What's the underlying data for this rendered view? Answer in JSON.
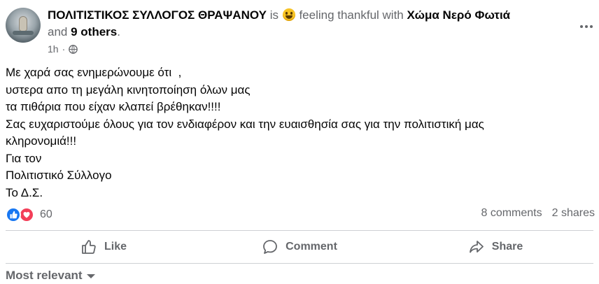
{
  "post": {
    "author": "ΠΟΛΙΤΙΣΤΙΚΟΣ ΣΥΛΛΟΓΟΣ ΘΡΑΨΑΝΟΥ",
    "is_text": "is",
    "feeling_text": "feeling thankful with",
    "tagged": "Χώμα Νερό Φωτιά",
    "and_text": "and",
    "others": "9 others",
    "period": ".",
    "time": "1h",
    "separator": "·",
    "privacy_icon": "globe-icon",
    "more_icon": "more-options-icon",
    "body_lines": [
      "Με χαρά σας ενημερώνουμε ότι  ,",
      "υστερα απο τη μεγάλη κινητοποίηση όλων μας",
      "τα πιθάρια που είχαν κλαπεί βρέθηκαν!!!!",
      "Σας ευχαριστούμε όλους για τον ενδιαφέρον και την ευαισθησία σας για την πολιτιστική μας",
      "κληρονομιά!!!",
      "Για τον",
      "Πολιτιστικό Σύλλογο",
      "Το Δ.Σ."
    ]
  },
  "engagement": {
    "reaction_count": "60",
    "comments": "8 comments",
    "shares": "2 shares"
  },
  "actions": {
    "like": "Like",
    "comment": "Comment",
    "share": "Share"
  },
  "comments_sort": {
    "label": "Most relevant"
  },
  "colors": {
    "like_blue": "#1877f2",
    "love_red": "#f33e58",
    "muted_text": "#65676b",
    "divider": "#ced0d4"
  }
}
